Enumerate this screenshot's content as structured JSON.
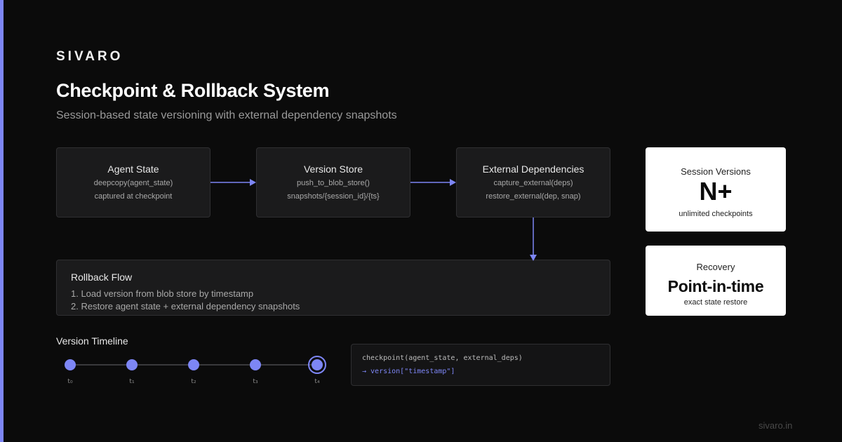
{
  "brand": {
    "logo": "SIVARO",
    "footer": "sivaro.in",
    "accent": "#7d86f5"
  },
  "header": {
    "title": "Checkpoint & Rollback System",
    "subtitle": "Session-based state versioning with external dependency snapshots"
  },
  "nodes": [
    {
      "title": "Agent State",
      "lines": [
        "deepcopy(agent_state)",
        "captured at checkpoint"
      ]
    },
    {
      "title": "Version Store",
      "lines": [
        "push_to_blob_store()",
        "snapshots/{session_id}/{ts}"
      ]
    },
    {
      "title": "External Dependencies",
      "lines": [
        "capture_external(deps)",
        "restore_external(dep, snap)"
      ]
    }
  ],
  "rollback": {
    "title": "Rollback Flow",
    "steps": [
      "1. Load version from blob store by timestamp",
      "2. Restore agent state + external dependency snapshots"
    ]
  },
  "stats": [
    {
      "label": "Session Versions",
      "value": "N+",
      "caption": "unlimited checkpoints"
    },
    {
      "label": "Recovery",
      "value": "Point-in-time",
      "caption": "exact state restore"
    }
  ],
  "timeline": {
    "label": "Version Timeline",
    "ticks": [
      "t₀",
      "t₁",
      "t₂",
      "t₃",
      "t₄"
    ],
    "active_index": 4
  },
  "code": {
    "line1": "checkpoint(agent_state, external_deps)",
    "line2": "→ version[\"timestamp\"]"
  }
}
